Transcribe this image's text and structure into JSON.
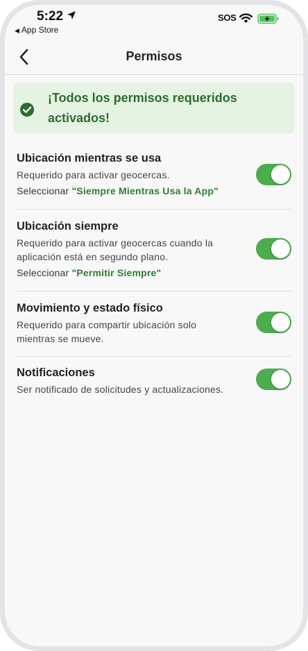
{
  "status_bar": {
    "time": "5:22",
    "back_app": "App Store",
    "sos": "SOS"
  },
  "nav": {
    "title": "Permisos"
  },
  "banner": {
    "text": "¡Todos los permisos requeridos activados!"
  },
  "permissions": [
    {
      "title": "Ubicación mientras se usa",
      "description": "Requerido para activar geocercas.",
      "hint_prefix": "Seleccionar ",
      "hint_option": "\"Siempre Mientras Usa la App\"",
      "enabled": true
    },
    {
      "title": "Ubicación siempre",
      "description": "Requerido para activar geocercas cuando la aplicación está en segundo plano.",
      "hint_prefix": "Seleccionar ",
      "hint_option": "\"Permitir Siempre\"",
      "enabled": true
    },
    {
      "title": "Movimiento y estado físico",
      "description": "Requerido para compartir ubicación solo mientras se mueve.",
      "enabled": true
    },
    {
      "title": "Notificaciones",
      "description": "Ser notificado de solicitudes y actualizaciones.",
      "enabled": true
    }
  ],
  "colors": {
    "accent_green": "#4cad4f",
    "banner_bg": "#e5f3e3",
    "banner_text": "#2f6b2f"
  }
}
